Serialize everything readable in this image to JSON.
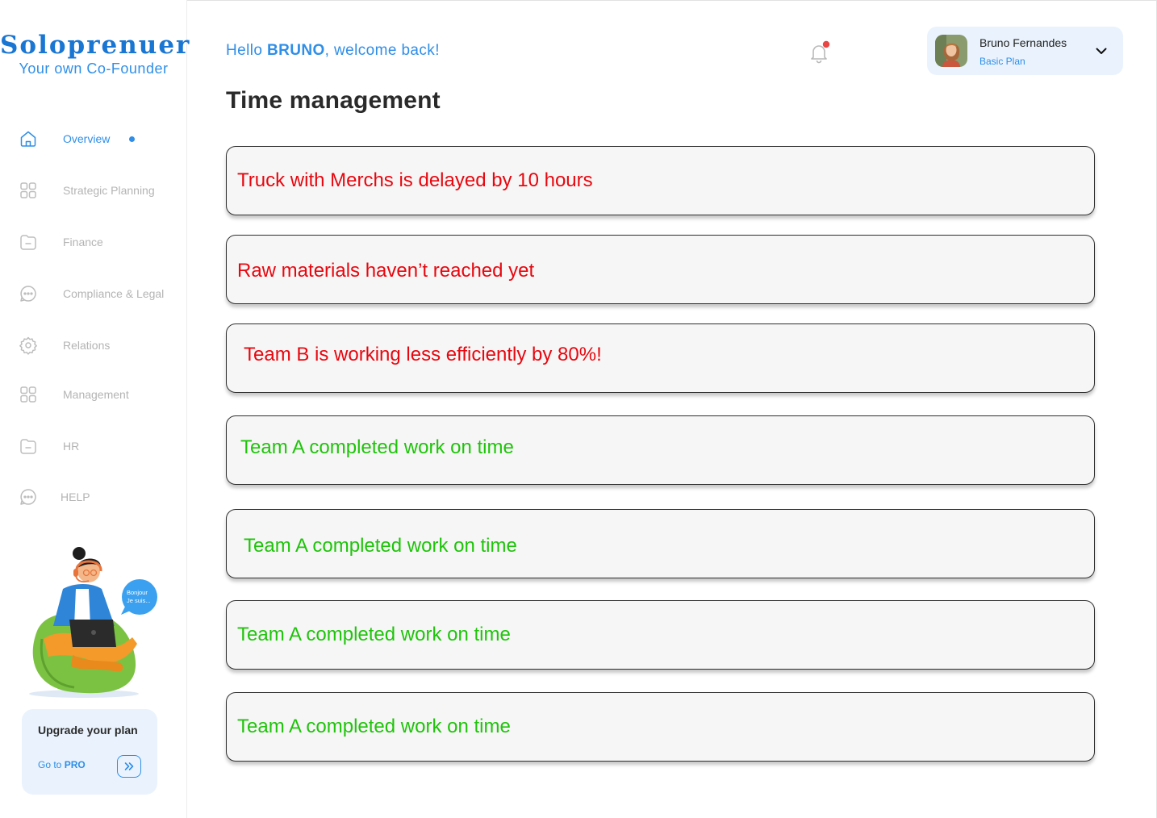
{
  "brand": {
    "title": "Soloprenuer",
    "subtitle": "Your own Co-Founder"
  },
  "colors": {
    "accent": "#2e8ee8",
    "alert_red": "#e8070f",
    "alert_green": "#1fc40b",
    "notification_dot": "#e84545"
  },
  "sidebar": {
    "items": [
      {
        "label": "Overview",
        "icon": "home-icon",
        "active": true
      },
      {
        "label": "Strategic Planning",
        "icon": "grid-icon",
        "active": false
      },
      {
        "label": "Finance",
        "icon": "folder-icon",
        "active": false
      },
      {
        "label": "Compliance & Legal",
        "icon": "chat-bubble-icon",
        "active": false
      },
      {
        "label": "Relations",
        "icon": "gear-icon",
        "active": false
      },
      {
        "label": "Management",
        "icon": "grid-icon",
        "active": false
      },
      {
        "label": "HR",
        "icon": "folder-icon",
        "active": false
      },
      {
        "label": "HELP",
        "icon": "chat-bubble-icon",
        "active": false
      }
    ],
    "illustration_bubble": "Bonjour\nJe suis...",
    "upgrade": {
      "title": "Upgrade your plan",
      "link_prefix": "Go to ",
      "link_strong": "PRO",
      "button_icon": "double-chevron-right-icon"
    }
  },
  "header": {
    "greeting_prefix": "Hello ",
    "greeting_name": "BRUNO",
    "greeting_suffix": ", welcome back!",
    "notification_icon": "bell-icon",
    "has_unread_notification": true,
    "profile": {
      "name": "Bruno Fernandes",
      "plan": "Basic Plan",
      "chevron_icon": "chevron-down-icon"
    }
  },
  "main": {
    "title": "Time management",
    "alerts": [
      {
        "text": "Truck with Merchs  is delayed by 10 hours",
        "status": "red"
      },
      {
        "text": "Raw materials haven’t reached yet",
        "status": "red"
      },
      {
        "text": "Team B is working less efficiently by 80%!",
        "status": "red"
      },
      {
        "text": "Team A completed work on time",
        "status": "green"
      },
      {
        "text": "Team A completed work on time",
        "status": "green"
      },
      {
        "text": "Team A completed work on time",
        "status": "green"
      },
      {
        "text": "Team A completed work on time",
        "status": "green"
      }
    ]
  }
}
